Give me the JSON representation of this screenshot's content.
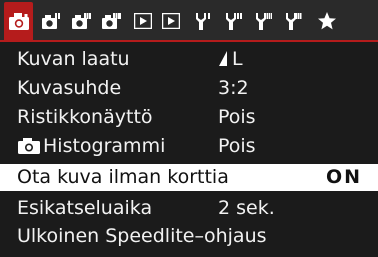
{
  "tabs": [
    {
      "id": "shoot-1",
      "icon": "camera-icon",
      "active": true
    },
    {
      "id": "shoot-2",
      "icon": "camera-icon",
      "active": false
    },
    {
      "id": "shoot-3",
      "icon": "camera-icon",
      "active": false
    },
    {
      "id": "shoot-4",
      "icon": "camera-icon",
      "active": false
    },
    {
      "id": "playback-1",
      "icon": "play-icon",
      "active": false
    },
    {
      "id": "playback-2",
      "icon": "play-icon",
      "active": false
    },
    {
      "id": "setup-1",
      "icon": "wrench-icon",
      "active": false
    },
    {
      "id": "setup-2",
      "icon": "wrench-icon",
      "active": false
    },
    {
      "id": "setup-3",
      "icon": "wrench-icon",
      "active": false
    },
    {
      "id": "setup-4",
      "icon": "wrench-icon",
      "active": false
    },
    {
      "id": "my-menu",
      "icon": "star-icon",
      "active": false
    }
  ],
  "menu": {
    "items": [
      {
        "label": "Kuvan laatu",
        "value": "L",
        "value_icon": "jpeg-large-fine-icon"
      },
      {
        "label": "Kuvasuhde",
        "value": "3:2"
      },
      {
        "label": "Ristikkonäyttö",
        "value": "Pois"
      },
      {
        "label": "Histogrammi",
        "label_icon": "camera-icon",
        "value": "Pois"
      },
      {
        "label": "Ota kuva ilman korttia",
        "value": "ON",
        "selected": true
      },
      {
        "label": "Esikatseluaika",
        "value": "2 sek."
      },
      {
        "label": "Ulkoinen Speedlite–ohjaus",
        "value": ""
      }
    ]
  },
  "colors": {
    "accent": "#b51c1c",
    "background": "#1b1b1b",
    "tabbar": "#2a2a2a",
    "selected_row": "#ffffff",
    "text": "#f2f2f2"
  }
}
